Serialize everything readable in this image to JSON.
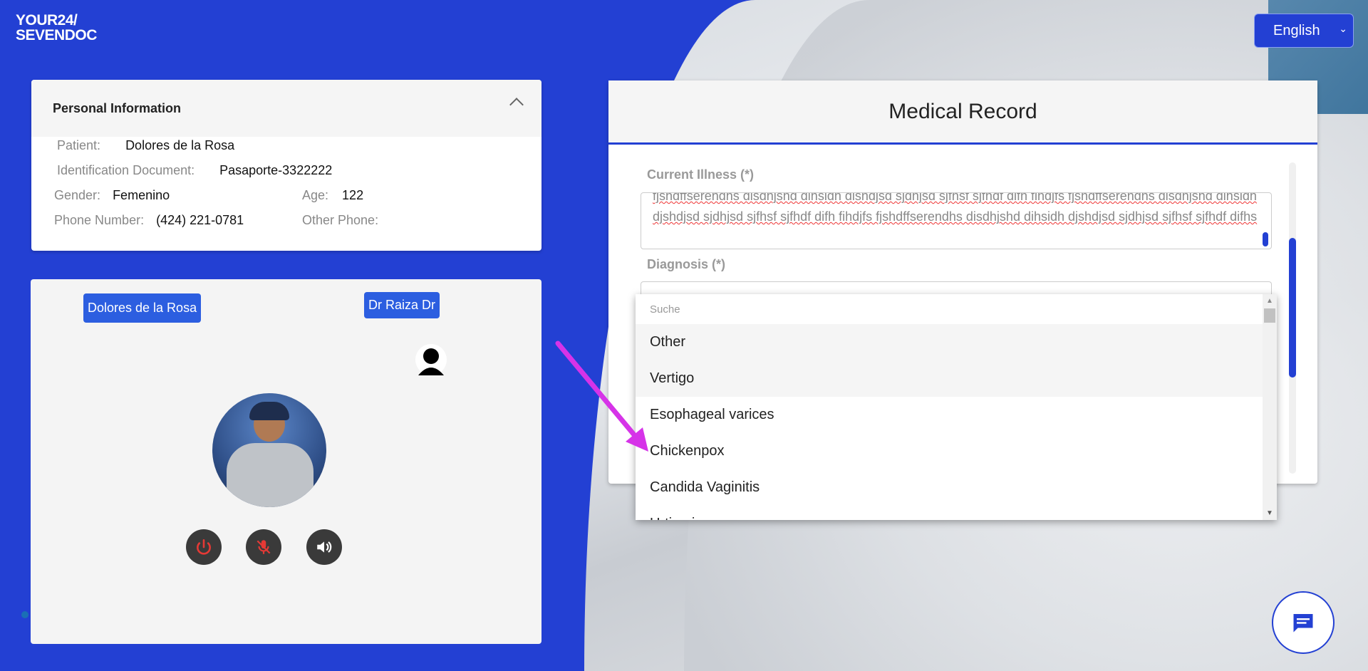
{
  "logo": {
    "line1": "YOUR24/",
    "line2": "SEVENDOC"
  },
  "language": {
    "selected": "English"
  },
  "personal": {
    "title": "Personal Information",
    "patient_label": "Patient:",
    "patient": "Dolores de la Rosa",
    "id_label": "Identification Document:",
    "id": "Pasaporte-3322222",
    "gender_label": "Gender:",
    "gender": "Femenino",
    "age_label": "Age:",
    "age": "122",
    "phone_label": "Phone Number:",
    "phone": "(424) 221-0781",
    "other_phone_label": "Other Phone:"
  },
  "video": {
    "patient_tag": "Dolores de la Rosa",
    "doctor_tag": "Dr Raiza Dr"
  },
  "medical": {
    "title": "Medical Record",
    "current_illness_label": "Current Illness (*)",
    "current_illness_text": "fjshdffserendhs disdhjshd dihsidh disndjsd sjdhjsd sjfhsf sjfhdf difh fihdjfs fjshdffserendhs disdhjshd dihsidh djshdjsd sjdhjsd sjfhsf sjfhdf difh fihdjfs fjshdffserendhs disdhjshd dihsidh djshdjsd sjdhjsd sjfhsf sjfhdf difhs",
    "diagnosis_label": "Diagnosis (*)"
  },
  "dropdown": {
    "search_placeholder": "Suche",
    "options": [
      "Other",
      "Vertigo",
      "Esophageal varices",
      "Chickenpox",
      "Candida Vaginitis",
      "Urticaria"
    ]
  },
  "colors": {
    "accent": "#2340d3",
    "arrow": "#d633e8"
  }
}
